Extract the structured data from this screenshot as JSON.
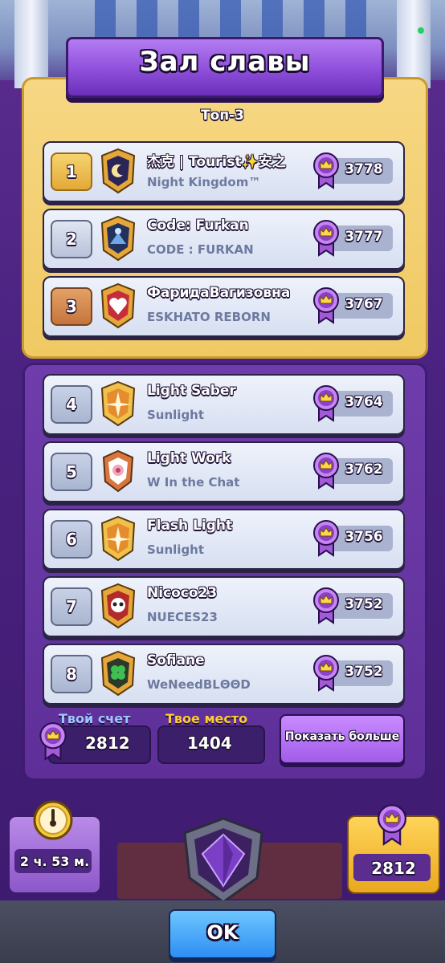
{
  "title": "Зал славы",
  "top3_label": "Топ-3",
  "players": [
    {
      "rank": "1",
      "name": "杰克 | Tourist✨安之",
      "clan": "Night Kingdom™",
      "trophies": "3778",
      "badge": "moon"
    },
    {
      "rank": "2",
      "name": "Code: Furkan",
      "clan": "CODE : FURKAN",
      "trophies": "3777",
      "badge": "mountain"
    },
    {
      "rank": "3",
      "name": "ФаридаВагизовна",
      "clan": "ESKHATO REBORN",
      "trophies": "3767",
      "badge": "heart"
    },
    {
      "rank": "4",
      "name": "Light Saber",
      "clan": "Sunlight",
      "trophies": "3764",
      "badge": "star"
    },
    {
      "rank": "5",
      "name": "Light Work",
      "clan": "W In the Chat",
      "trophies": "3762",
      "badge": "flower"
    },
    {
      "rank": "6",
      "name": "Flash Light",
      "clan": "Sunlight",
      "trophies": "3756",
      "badge": "star"
    },
    {
      "rank": "7",
      "name": "Nicoco23",
      "clan": "NUECES23",
      "trophies": "3752",
      "badge": "skull"
    },
    {
      "rank": "8",
      "name": "Sofiane",
      "clan": "WeNeedBLΘΘD",
      "trophies": "3752",
      "badge": "clover"
    }
  ],
  "footer": {
    "your_score_label": "Твой счет",
    "your_score": "2812",
    "your_place_label": "Твое место",
    "your_place": "1404",
    "show_more": "Показать больше"
  },
  "timer": "2 ч. 53 м.",
  "trophy_count": "2812",
  "ok_label": "OK",
  "colors": {
    "gold_panel": "#f0c962",
    "purple_panel": "#5e2f98",
    "ok_button": "#2e8ef2"
  }
}
